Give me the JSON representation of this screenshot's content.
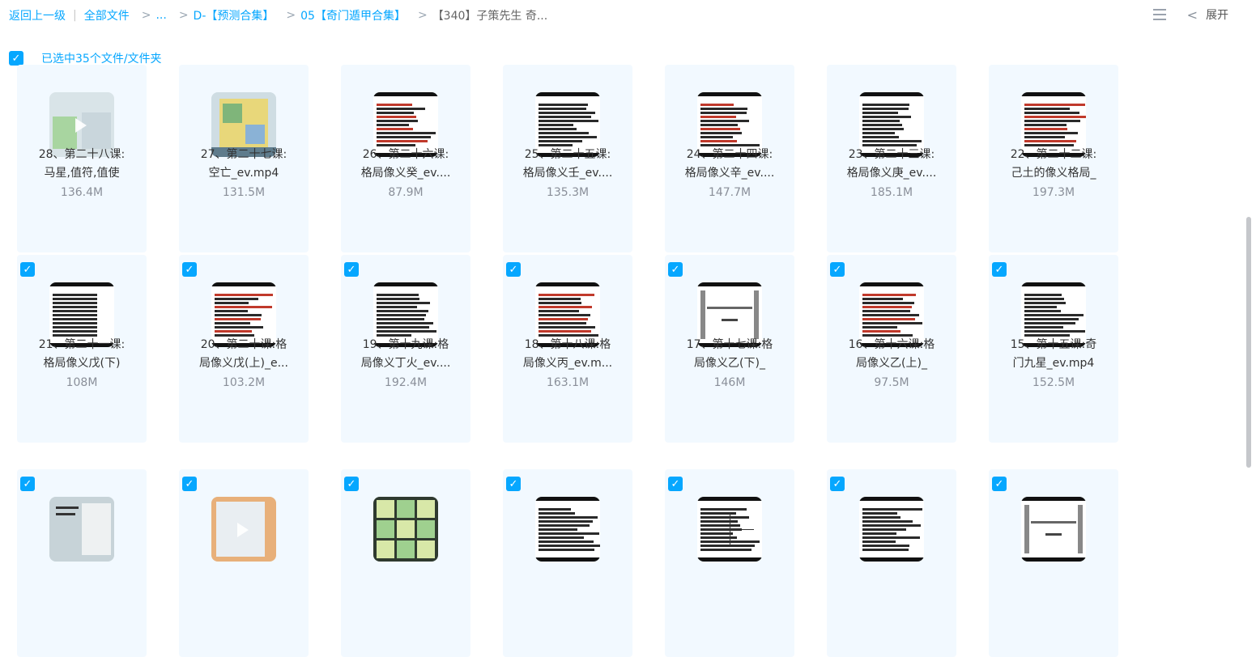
{
  "breadcrumb": {
    "back": "返回上一级",
    "items": [
      "全部文件",
      "...",
      "D-【预测合集】",
      "05【奇门遁甲合集】",
      "【340】子策先生 奇..."
    ]
  },
  "toolbar": {
    "expand_label": "展开"
  },
  "selection": {
    "text": "已选中35个文件/文件夹"
  },
  "check_mark": "✓",
  "files": [
    {
      "line1": "28、第二十八课:",
      "line2": "马星,值符,值使",
      "size": "136.4M",
      "thumb": "video",
      "checked": false
    },
    {
      "line1": "27、第二十七课:",
      "line2": "空亡_ev.mp4",
      "size": "131.5M",
      "thumb": "map",
      "checked": false
    },
    {
      "line1": "26、第二十六课:",
      "line2": "格局像义癸_ev....",
      "size": "87.9M",
      "thumb": "doc",
      "checked": false
    },
    {
      "line1": "25、第二十五课:",
      "line2": "格局像义壬_ev....",
      "size": "135.3M",
      "thumb": "doc",
      "checked": false
    },
    {
      "line1": "24、第二十四课:",
      "line2": "格局像义辛_ev....",
      "size": "147.7M",
      "thumb": "doc",
      "checked": false
    },
    {
      "line1": "23、第二十三课:",
      "line2": "格局像义庚_ev....",
      "size": "185.1M",
      "thumb": "doc",
      "checked": false
    },
    {
      "line1": "22、第二十二课:",
      "line2": "己土的像义格局_",
      "size": "197.3M",
      "thumb": "doc",
      "checked": false
    },
    {
      "line1": "21、第二十一课:",
      "line2": "格局像义戊(下)",
      "size": "108M",
      "thumb": "doc",
      "checked": true
    },
    {
      "line1": "20、第二十课:格",
      "line2": "局像义戊(上)_e...",
      "size": "103.2M",
      "thumb": "doc",
      "checked": true
    },
    {
      "line1": "19、第十九课:格",
      "line2": "局像义丁火_ev....",
      "size": "192.4M",
      "thumb": "doc",
      "checked": true
    },
    {
      "line1": "18、第十八课:格",
      "line2": "局像义丙_ev.m...",
      "size": "163.1M",
      "thumb": "doc",
      "checked": true
    },
    {
      "line1": "17、第十七课:格",
      "line2": "局像义乙(下)_",
      "size": "146M",
      "thumb": "scroll",
      "checked": true
    },
    {
      "line1": "16、第十六课:格",
      "line2": "局像义乙(上)_",
      "size": "97.5M",
      "thumb": "doc",
      "checked": true
    },
    {
      "line1": "15、第十五课:奇",
      "line2": "门九星_ev.mp4",
      "size": "152.5M",
      "thumb": "doc",
      "checked": true
    },
    {
      "line1": "",
      "line2": "",
      "size": "",
      "thumb": "tiger",
      "checked": true
    },
    {
      "line1": "",
      "line2": "",
      "size": "",
      "thumb": "video2",
      "checked": true
    },
    {
      "line1": "",
      "line2": "",
      "size": "",
      "thumb": "grid",
      "checked": true
    },
    {
      "line1": "",
      "line2": "",
      "size": "",
      "thumb": "doc",
      "checked": true
    },
    {
      "line1": "",
      "line2": "",
      "size": "",
      "thumb": "table",
      "checked": true
    },
    {
      "line1": "",
      "line2": "",
      "size": "",
      "thumb": "doc",
      "checked": true
    },
    {
      "line1": "",
      "line2": "",
      "size": "",
      "thumb": "scroll",
      "checked": true
    }
  ]
}
